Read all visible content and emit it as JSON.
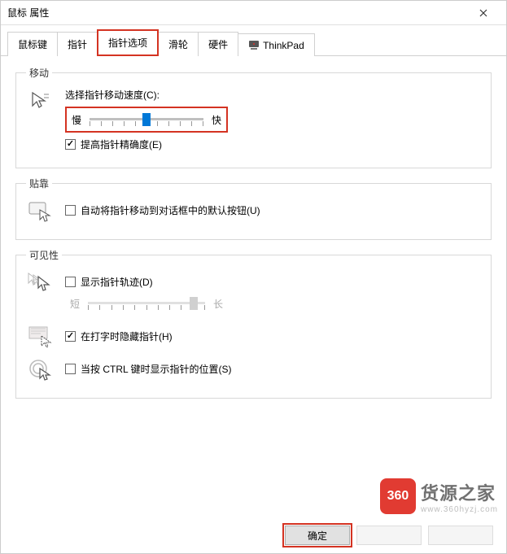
{
  "window": {
    "title": "鼠标 属性"
  },
  "tabs": {
    "buttons": "鼠标键",
    "pointers": "指针",
    "pointer_options": "指针选项",
    "wheel": "滑轮",
    "hardware": "硬件",
    "thinkpad": "ThinkPad"
  },
  "groups": {
    "motion": {
      "legend": "移动",
      "speed_label": "选择指针移动速度(C):",
      "slow": "慢",
      "fast": "快",
      "slider_value": 5,
      "slider_max": 10,
      "precision_checkbox": "提高指针精确度(E)",
      "precision_checked": true
    },
    "snap": {
      "legend": "贴靠",
      "auto_move": "自动将指针移动到对话框中的默认按钮(U)",
      "auto_move_checked": false
    },
    "visibility": {
      "legend": "可见性",
      "trails": "显示指针轨迹(D)",
      "trails_checked": false,
      "trail_short": "短",
      "trail_long": "长",
      "trail_value": 9,
      "trail_max": 10,
      "hide_typing": "在打字时隐藏指针(H)",
      "hide_typing_checked": true,
      "ctrl_locate": "当按 CTRL 键时显示指针的位置(S)",
      "ctrl_locate_checked": false
    }
  },
  "buttons": {
    "ok": "确定"
  },
  "watermark": {
    "badge": "360",
    "text": "货源之家",
    "sub": "www.360hyzj.com"
  }
}
